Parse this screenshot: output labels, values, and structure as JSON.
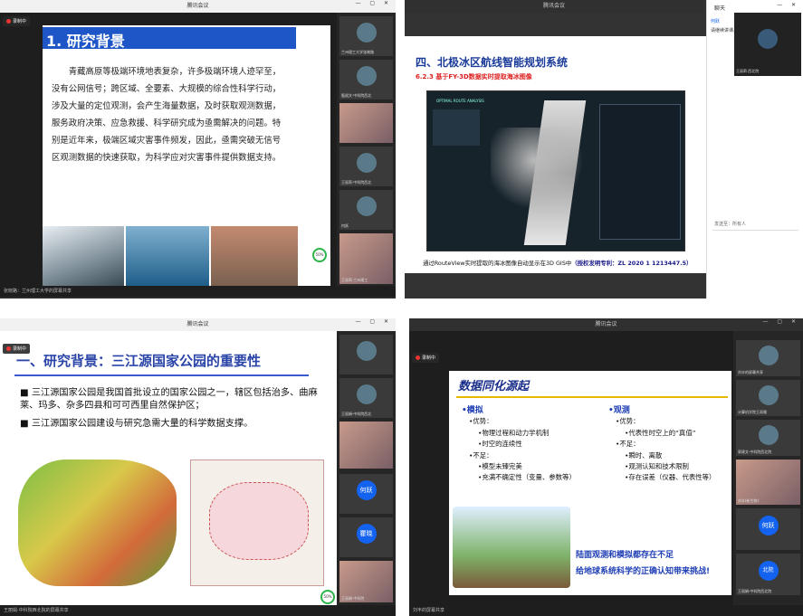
{
  "q1": {
    "title": "腾讯会议",
    "recording": "录制中",
    "slide_title": "1. 研究背景",
    "para": "青藏高原等极端环境地表复杂，许多极端环境人迹罕至，没有公网信号；跨区域、全要素、大规模的综合性科学行动，涉及大量的定位观测，会产生海量数据，及时获取观测数据，服务政府决策、应急救援、科学研究成为亟需解决的问题。特别是近年来，极端区域灾害事件频发，因此，亟需突破无信号区观测数据的快速获取，为科学应对灾害事件提供数据支持。",
    "percent": "50%",
    "share": "张晓路：兰州理工大学的屏幕共享",
    "participants": [
      "兰州理工大学张晓路",
      "甄斌文·中科院西北",
      "",
      "王丽莉·中科院西北",
      "何跃",
      "蒲宇",
      "王丽莉·兰州理工"
    ]
  },
  "q2": {
    "title": "腾讯会议",
    "slide_title": "四、北极冰区航线智能规划系统",
    "sub": "6.2.3 基于FY-3D数据实时提取海冰图像",
    "app": "OPTIMAL ROUTE ANALYSIS",
    "caption": "通过RouteView实时提取的海冰图像自动显示在3D GIS中",
    "patent": "（授权发明专利：ZL 2020 1 1213447.5）",
    "chat_title": "聊天",
    "chat_user": "何跃",
    "chat_msg": "请继续讲课。",
    "chat_name": "王丽莉·西北院",
    "send_to": "发送至：所有人"
  },
  "q3": {
    "title": "腾讯会议",
    "recording": "录制中",
    "slide_title": "一、研究背景：三江源国家公园的重要性",
    "b1": "三江源国家公园是我国首批设立的国家公园之一，辖区包括治多、曲麻莱、玛多、杂多四县和可可西里自然保护区；",
    "b2": "三江源国家公园建设与研究急需大量的科学数据支撑。",
    "percent": "50%",
    "share": "王丽娟·中科院西北院的屏幕共享",
    "participants": [
      "",
      "王丽娟·中科院西北",
      "",
      "何跃",
      "瞿晓",
      "王丽娟·中科院"
    ]
  },
  "q4": {
    "title": "腾讯会议",
    "recording": "录制中",
    "slide_title": "数据同化源起",
    "m_head": "•模拟",
    "m_adv": "•优势：",
    "m_a1": "•物理过程和动力学机制",
    "m_a2": "•时空的连续性",
    "m_dis": "•不足：",
    "m_d1": "•模型未臻完美",
    "m_d2": "•充满不确定性（变量、参数等）",
    "o_head": "•观测",
    "o_adv": "•优势：",
    "o_a1": "•代表性时空上的“真值”",
    "o_dis": "•不足：",
    "o_d1": "•瞬时、离散",
    "o_d2": "•观测认知和技术限制",
    "o_d3": "•存在误差（仪器、代表性等）",
    "conc1": "陆面观测和模拟都存在不足",
    "conc2": "给地球系统科学的正确认知带来挑战!",
    "share": "刘丰的屏幕共享",
    "participants": [
      "刘丰的屏幕共享",
      "计算机学院王雨雅",
      "郭建文·中科院西北院",
      "刘丰(新生物)",
      "何跃",
      "王丽娟·中科院西北院"
    ]
  }
}
